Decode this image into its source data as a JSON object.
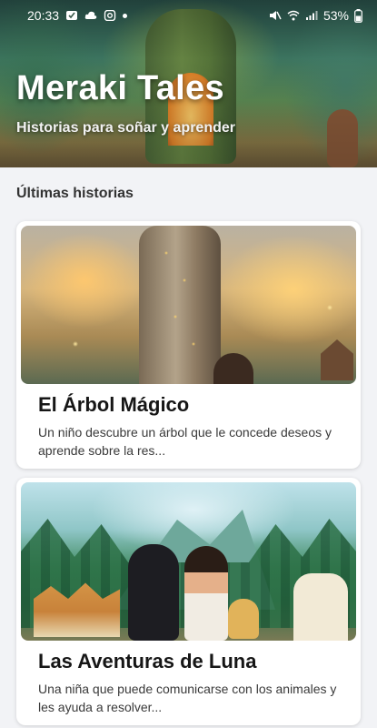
{
  "status_bar": {
    "time": "20:33",
    "battery": "53%",
    "left_icons": [
      "check-notification-icon",
      "cloud-icon",
      "instagram-icon"
    ],
    "right_icons": [
      "mute-icon",
      "wifi-icon",
      "signal-icon",
      "battery-icon"
    ]
  },
  "hero": {
    "title": "Meraki Tales",
    "subtitle": "Historias para soñar y aprender"
  },
  "section": {
    "title": "Últimas historias"
  },
  "stories": [
    {
      "title": "El Árbol Mágico",
      "description": "Un niño descubre un árbol que le concede deseos y aprende sobre la res..."
    },
    {
      "title": "Las Aventuras de Luna",
      "description": "Una niña que puede comunicarse con los animales y les ayuda a resolver..."
    }
  ]
}
